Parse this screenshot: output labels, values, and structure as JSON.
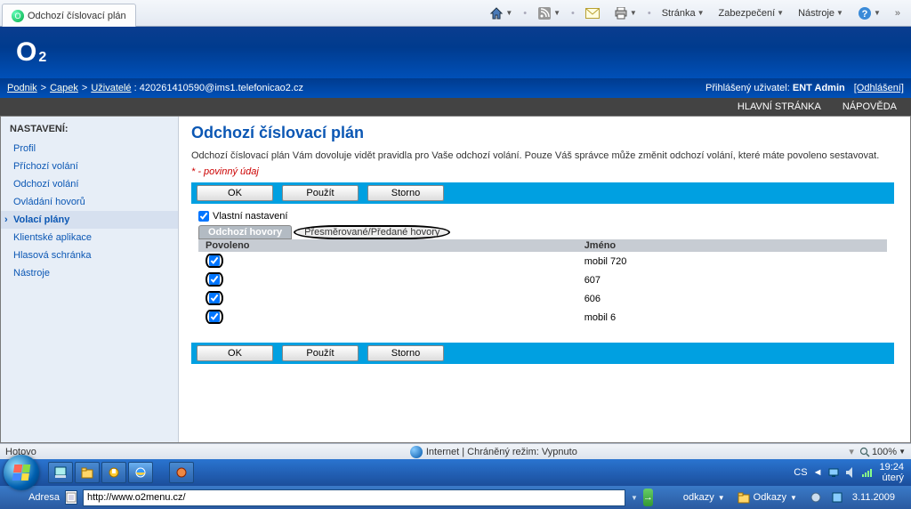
{
  "ie": {
    "tab_title": "Odchozí číslovací plán",
    "home_icon": "home-icon",
    "menu": {
      "page": "Stránka",
      "security": "Zabezpečení",
      "tools": "Nástroje",
      "help_icon": "help-icon"
    }
  },
  "o2": {
    "logo_big": "O",
    "logo_sub": "2"
  },
  "breadcrumb": {
    "items": [
      "Podnik",
      "Capek",
      "Uživatelé"
    ],
    "user_id_label": ":",
    "user_id": "420261410590@ims1.telefonicao2.cz",
    "logged_in_label": "Přihlášený uživatel:",
    "logged_in_user": "ENT Admin",
    "logout": "[Odhlášení]"
  },
  "menubar": {
    "home": "HLAVNÍ STRÁNKA",
    "help": "NÁPOVĚDA"
  },
  "sidebar": {
    "title": "NASTAVENÍ:",
    "items": [
      {
        "label": "Profil"
      },
      {
        "label": "Příchozí volání"
      },
      {
        "label": "Odchozí volání"
      },
      {
        "label": "Ovládání hovorů"
      },
      {
        "label": "Volací plány",
        "active": true
      },
      {
        "label": "Klientské aplikace"
      },
      {
        "label": "Hlasová schránka"
      },
      {
        "label": "Nástroje"
      }
    ]
  },
  "page": {
    "title": "Odchozí číslovací plán",
    "description": "Odchozí číslovací plán Vám dovoluje vidět pravidla pro Vaše odchozí volání. Pouze Váš správce může změnit odchozí volání, které máte povoleno sestavovat.",
    "required_note": "* - povinný údaj",
    "buttons": {
      "ok": "OK",
      "apply": "Použít",
      "cancel": "Storno"
    },
    "own_settings": "Vlastní nastavení",
    "tabs": {
      "outgoing": "Odchozí hovory",
      "forwarded": "Přesměrované/Předané hovory"
    },
    "table": {
      "col_allowed": "Povoleno",
      "col_name": "Jméno",
      "rows": [
        {
          "allowed": true,
          "name": "mobil 720"
        },
        {
          "allowed": true,
          "name": "607"
        },
        {
          "allowed": true,
          "name": "606"
        },
        {
          "allowed": true,
          "name": "mobil 6"
        }
      ]
    }
  },
  "status": {
    "done": "Hotovo",
    "zone": "Internet | Chráněný režim: Vypnuto",
    "zoom": "100%"
  },
  "taskbar": {
    "lang": "CS",
    "time": "19:24",
    "day": "úterý",
    "date": "3.11.2009"
  },
  "addr": {
    "label": "Adresa",
    "url": "http://www.o2menu.cz/",
    "links_word": "odkazy",
    "links_menu": "Odkazy"
  }
}
